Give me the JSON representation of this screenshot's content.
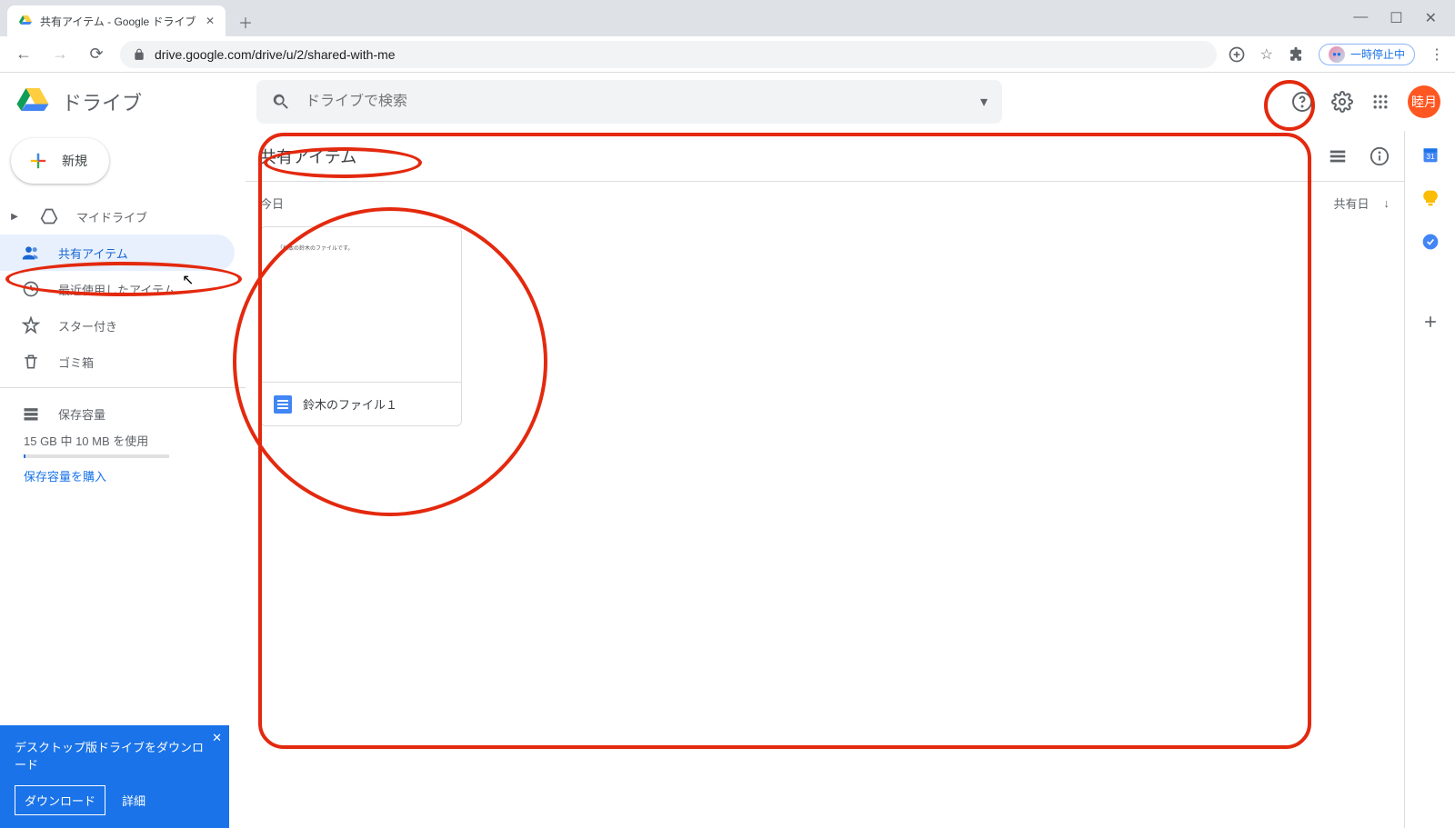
{
  "browser": {
    "tab_title": "共有アイテム - Google ドライブ",
    "url_display": "drive.google.com/drive/u/2/shared-with-me",
    "paused_label": "一時停止中"
  },
  "header": {
    "product_name": "ドライブ",
    "search_placeholder": "ドライブで検索",
    "avatar_text": "睦月"
  },
  "sidebar": {
    "new_button": "新規",
    "items": [
      {
        "label": "マイドライブ",
        "icon": "drive"
      },
      {
        "label": "共有アイテム",
        "icon": "people"
      },
      {
        "label": "最近使用したアイテム",
        "icon": "clock"
      },
      {
        "label": "スター付き",
        "icon": "star"
      },
      {
        "label": "ゴミ箱",
        "icon": "trash"
      }
    ],
    "storage_label": "保存容量",
    "storage_text": "15 GB 中 10 MB を使用",
    "buy_storage": "保存容量を購入",
    "promo_text": "デスクトップ版ドライブをダウンロード",
    "promo_download": "ダウンロード",
    "promo_detail": "詳細"
  },
  "main": {
    "title": "共有アイテム",
    "section": "今日",
    "sort_label": "共有日",
    "files": [
      {
        "name": "鈴木のファイル１",
        "thumb_text": "「様本の鈴木のファイルです。"
      }
    ]
  },
  "side_panel_icons": [
    "calendar",
    "keep",
    "tasks",
    "plus"
  ]
}
